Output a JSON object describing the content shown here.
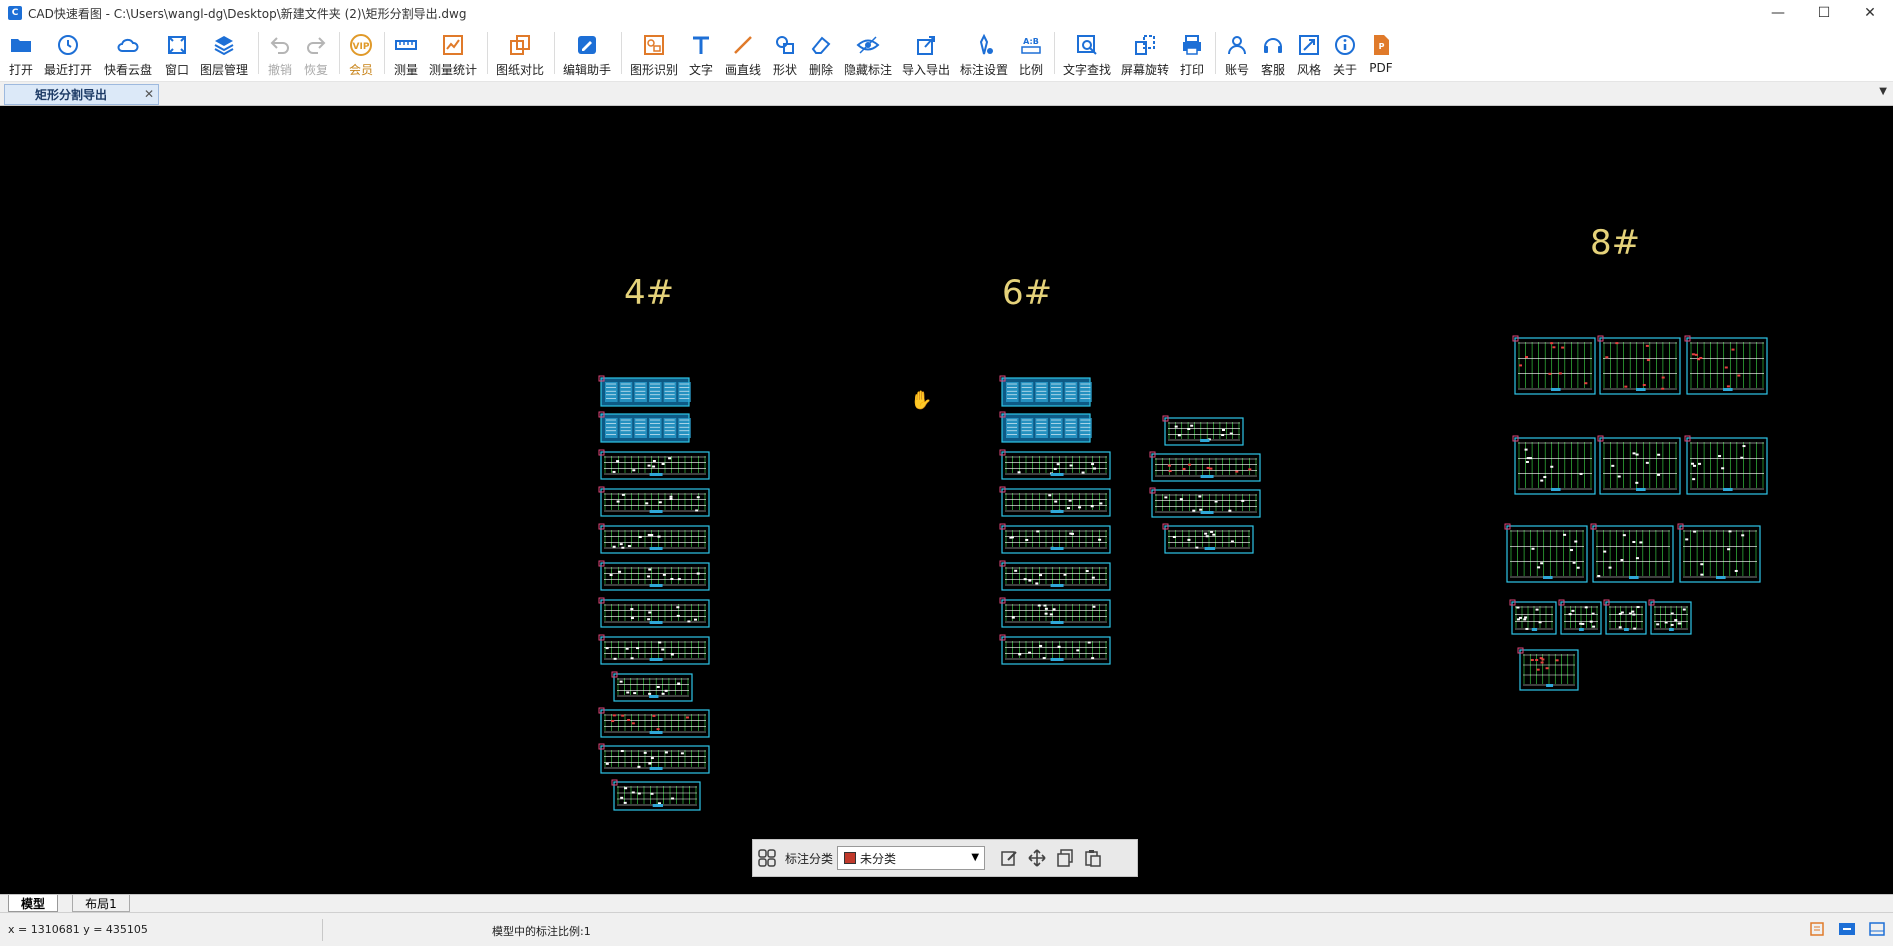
{
  "window": {
    "title": "CAD快速看图 - C:\\Users\\wangl-dg\\Desktop\\新建文件夹 (2)\\矩形分割导出.dwg",
    "minimize": "—",
    "maximize": "☐",
    "close": "✕"
  },
  "toolbar": {
    "items": [
      {
        "label": "打开",
        "icon": "folder-icon",
        "color": "#1d6fd6"
      },
      {
        "label": "最近打开",
        "icon": "clock-icon",
        "color": "#1d6fd6"
      },
      {
        "label": "快看云盘",
        "icon": "cloud-icon",
        "color": "#1d6fd6"
      },
      {
        "label": "窗口",
        "icon": "window-icon",
        "color": "#1d6fd6"
      },
      {
        "label": "图层管理",
        "icon": "layers-icon",
        "color": "#1d6fd6"
      },
      {
        "label": "撤销",
        "icon": "undo-icon",
        "color": "#b5b5b5"
      },
      {
        "label": "恢复",
        "icon": "redo-icon",
        "color": "#b5b5b5"
      },
      {
        "label": "会员",
        "icon": "vip-icon",
        "color": "#e09a2a"
      },
      {
        "label": "测量",
        "icon": "ruler-icon",
        "color": "#1d6fd6"
      },
      {
        "label": "测量统计",
        "icon": "stats-icon",
        "color": "#e07a2a"
      },
      {
        "label": "图纸对比",
        "icon": "compare-icon",
        "color": "#e07a2a"
      },
      {
        "label": "编辑助手",
        "icon": "edit-assistant-icon",
        "color": "#1d6fd6"
      },
      {
        "label": "图形识别",
        "icon": "shape-recognize-icon",
        "color": "#e07a2a"
      },
      {
        "label": "文字",
        "icon": "text-icon",
        "color": "#1d6fd6"
      },
      {
        "label": "画直线",
        "icon": "line-icon",
        "color": "#e07a2a"
      },
      {
        "label": "形状",
        "icon": "shapes-icon",
        "color": "#1d6fd6"
      },
      {
        "label": "删除",
        "icon": "eraser-icon",
        "color": "#1d6fd6"
      },
      {
        "label": "隐藏标注",
        "icon": "eye-icon",
        "color": "#1d6fd6"
      },
      {
        "label": "导入导出",
        "icon": "import-export-icon",
        "color": "#1d6fd6"
      },
      {
        "label": "标注设置",
        "icon": "annotation-settings-icon",
        "color": "#1d6fd6"
      },
      {
        "label": "比例",
        "icon": "scale-icon",
        "color": "#1d6fd6"
      },
      {
        "label": "文字查找",
        "icon": "text-search-icon",
        "color": "#1d6fd6"
      },
      {
        "label": "屏幕旋转",
        "icon": "rotate-icon",
        "color": "#1d6fd6"
      },
      {
        "label": "打印",
        "icon": "printer-icon",
        "color": "#1d6fd6"
      },
      {
        "label": "账号",
        "icon": "user-icon",
        "color": "#1d6fd6"
      },
      {
        "label": "客服",
        "icon": "headset-icon",
        "color": "#1d6fd6"
      },
      {
        "label": "风格",
        "icon": "style-icon",
        "color": "#1d6fd6"
      },
      {
        "label": "关于",
        "icon": "info-icon",
        "color": "#1d6fd6"
      },
      {
        "label": "PDF",
        "icon": "pdf-icon",
        "color": "#e07a2a"
      }
    ]
  },
  "tabs": {
    "document": "矩形分割导出",
    "close": "✕",
    "dropdown": "▼"
  },
  "drawing": {
    "group_labels": [
      "4#",
      "6#",
      "8#"
    ],
    "label_color": "#e5d27a",
    "frame_color": "#2ec6e8",
    "content_color": "#3fe04a",
    "marker_color": "#e0467a"
  },
  "annotation_bar": {
    "label": "标注分类",
    "selected": "未分类",
    "swatch_color": "#c0392b"
  },
  "layout_tabs": [
    "模型",
    "布局1"
  ],
  "status": {
    "coords": "x = 1310681  y = 435105",
    "scale": "模型中的标注比例:1"
  }
}
